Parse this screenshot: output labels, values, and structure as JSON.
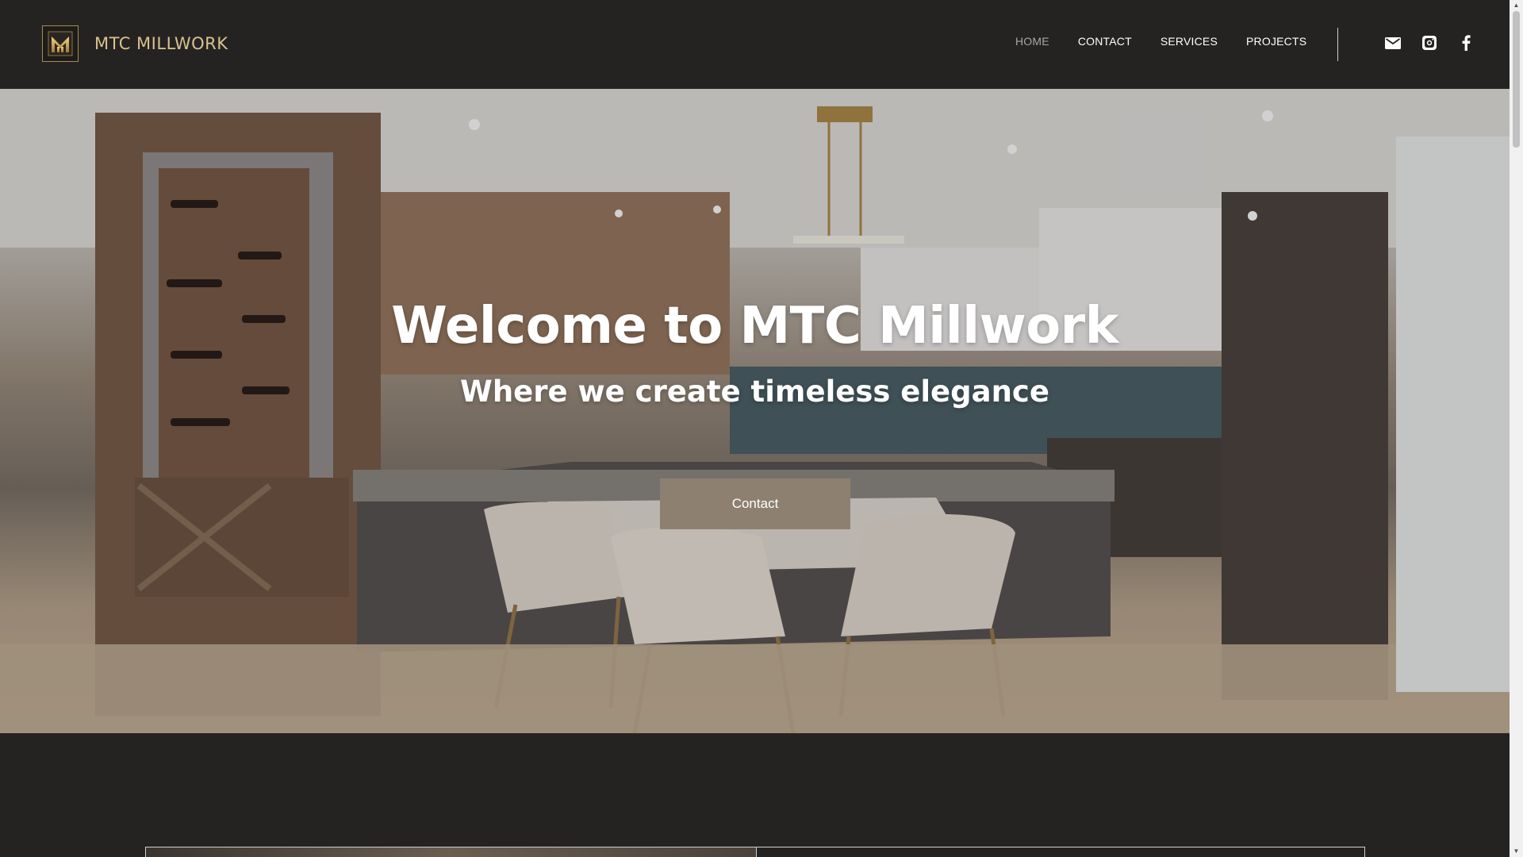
{
  "brand": {
    "name": "MTC MILLWORK",
    "logo_letter": "M"
  },
  "nav": {
    "items": [
      {
        "label": "HOME",
        "active": true
      },
      {
        "label": "CONTACT",
        "active": false
      },
      {
        "label": "SERVICES",
        "active": false
      },
      {
        "label": "PROJECTS",
        "active": false
      }
    ]
  },
  "social": {
    "icons": [
      "mail-icon",
      "instagram-icon",
      "facebook-icon"
    ]
  },
  "hero": {
    "title": "Welcome to MTC Millwork",
    "subtitle": "Where we create timeless elegance",
    "button_label": "Contact"
  },
  "colors": {
    "background": "#252322",
    "accent_gold": "#d9c28d",
    "button": "#8e8070"
  }
}
